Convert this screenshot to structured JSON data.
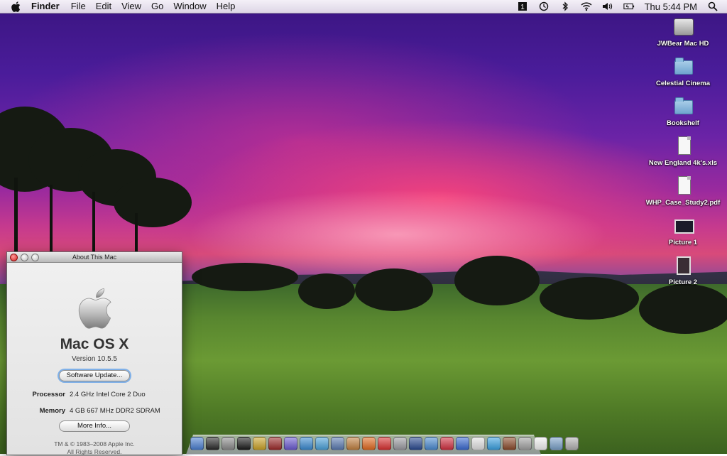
{
  "menubar": {
    "app_name": "Finder",
    "menus": [
      "File",
      "Edit",
      "View",
      "Go",
      "Window",
      "Help"
    ],
    "clock": "Thu 5:44 PM",
    "status_icons": [
      "spaces-icon",
      "time-machine-icon",
      "bluetooth-icon",
      "wifi-icon",
      "volume-icon",
      "battery-icon"
    ]
  },
  "desktop_icons": [
    {
      "label": "JWBear Mac HD",
      "icon": "hard-drive-icon"
    },
    {
      "label": "Celestial Cinema",
      "icon": "folder-icon"
    },
    {
      "label": "Bookshelf",
      "icon": "folder-icon"
    },
    {
      "label": "New England 4k's.xls",
      "icon": "spreadsheet-document-icon"
    },
    {
      "label": "WHP_Case_Study2.pdf",
      "icon": "pdf-document-icon"
    },
    {
      "label": "Picture 1",
      "icon": "screenshot-image-icon"
    },
    {
      "label": "Picture 2",
      "icon": "photo-image-icon"
    }
  ],
  "about_window": {
    "title": "About This Mac",
    "os_name": "Mac OS X",
    "version": "Version 10.5.5",
    "software_update_button": "Software Update...",
    "processor_label": "Processor",
    "processor_value": "2.4 GHz Intel Core 2 Duo",
    "memory_label": "Memory",
    "memory_value": "4 GB 667 MHz DDR2 SDRAM",
    "more_info_button": "More Info...",
    "legal_line1": "TM & © 1983–2008 Apple Inc.",
    "legal_line2": "All Rights Reserved."
  },
  "dock": {
    "items": [
      {
        "name": "finder",
        "color": "#4a7fd0"
      },
      {
        "name": "dashboard",
        "color": "#2a2a2a"
      },
      {
        "name": "system-preferences",
        "color": "#8a8a8a"
      },
      {
        "name": "terminal",
        "color": "#1a1a1a"
      },
      {
        "name": "automator",
        "color": "#c9a227"
      },
      {
        "name": "dictionary",
        "color": "#9b2a2a"
      },
      {
        "name": "ichat",
        "color": "#6a5ad0"
      },
      {
        "name": "safari",
        "color": "#3a8ad0"
      },
      {
        "name": "itunes",
        "color": "#4aa0d8"
      },
      {
        "name": "mail",
        "color": "#5a7ab0"
      },
      {
        "name": "iphoto",
        "color": "#c08040"
      },
      {
        "name": "firefox",
        "color": "#e06a20"
      },
      {
        "name": "ical",
        "color": "#d83030"
      },
      {
        "name": "preview",
        "color": "#9a9aa0"
      },
      {
        "name": "google-earth",
        "color": "#2a4a90"
      },
      {
        "name": "quicktime",
        "color": "#4a8ad0"
      },
      {
        "name": "app-red",
        "color": "#d03040"
      },
      {
        "name": "word",
        "color": "#3a6ad0"
      },
      {
        "name": "textedit",
        "color": "#e0e0e0"
      },
      {
        "name": "itunes-blue",
        "color": "#3aa0e0"
      },
      {
        "name": "app-brown",
        "color": "#8a4a2a"
      },
      {
        "name": "app-gray",
        "color": "#a0a0a0"
      },
      {
        "name": "documents-stack",
        "color": "#f0f0f0"
      },
      {
        "name": "downloads-stack",
        "color": "#7aa0c8"
      },
      {
        "name": "trash",
        "color": "#b0b0b0"
      }
    ]
  }
}
